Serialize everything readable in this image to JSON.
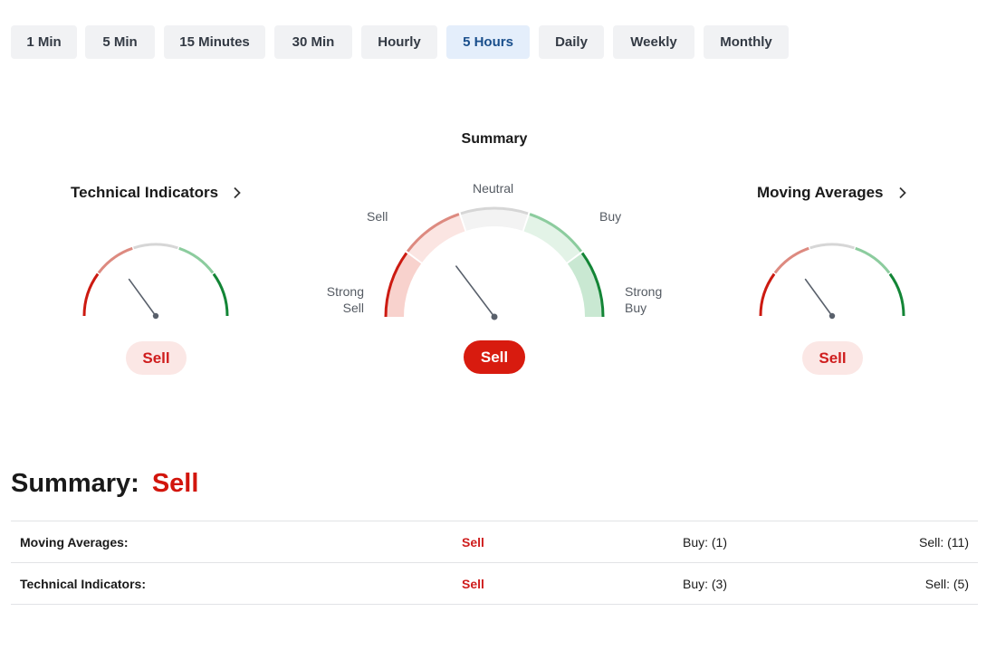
{
  "timeframes": [
    {
      "label": "1 Min",
      "active": false
    },
    {
      "label": "5 Min",
      "active": false
    },
    {
      "label": "15 Minutes",
      "active": false
    },
    {
      "label": "30 Min",
      "active": false
    },
    {
      "label": "Hourly",
      "active": false
    },
    {
      "label": "5 Hours",
      "active": true
    },
    {
      "label": "Daily",
      "active": false
    },
    {
      "label": "Weekly",
      "active": false
    },
    {
      "label": "Monthly",
      "active": false
    }
  ],
  "gauges": {
    "technical": {
      "title": "Technical Indicators",
      "verdict": "Sell",
      "icon": "chevron-right-icon"
    },
    "summary": {
      "title": "Summary",
      "verdict": "Sell"
    },
    "moving": {
      "title": "Moving Averages",
      "verdict": "Sell",
      "icon": "chevron-right-icon"
    }
  },
  "scale_labels": {
    "strong_sell_line1": "Strong",
    "strong_sell_line2": "Sell",
    "sell": "Sell",
    "neutral": "Neutral",
    "buy": "Buy",
    "strong_buy_line1": "Strong",
    "strong_buy_line2": "Buy"
  },
  "summary": {
    "label": "Summary:",
    "verdict": "Sell",
    "rows": [
      {
        "name": "Moving Averages:",
        "action": "Sell",
        "buy": "Buy: (1)",
        "sell": "Sell: (11)"
      },
      {
        "name": "Technical Indicators:",
        "action": "Sell",
        "buy": "Buy: (3)",
        "sell": "Sell: (5)"
      }
    ]
  },
  "colors": {
    "strong_sell": "#cc1a11",
    "sell": "#dd8a80",
    "neutral": "#d6d6d6",
    "buy": "#8ccc9e",
    "strong_buy": "#138536",
    "needle": "#59606b"
  }
}
